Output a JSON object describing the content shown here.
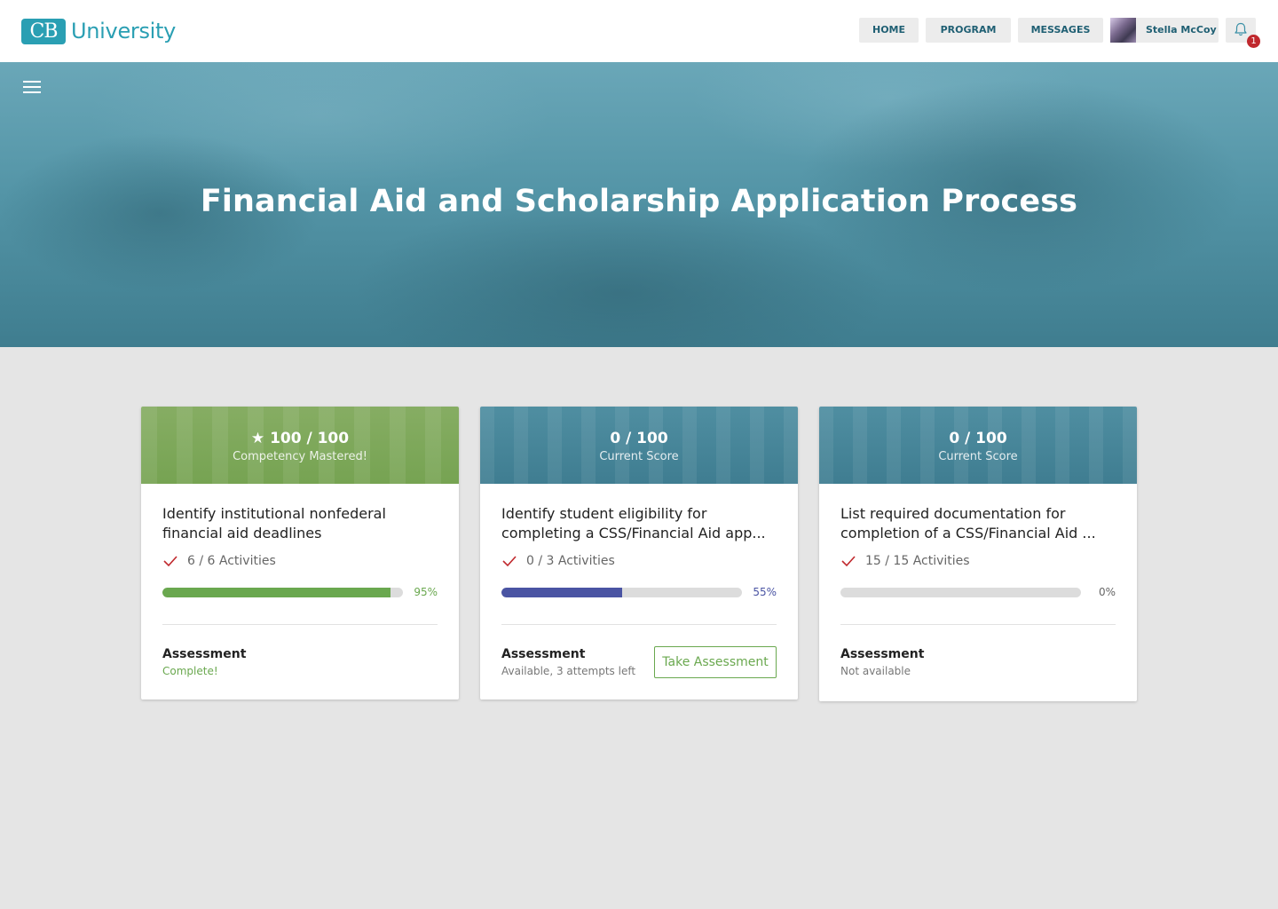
{
  "brand": {
    "mark": "CB",
    "name": "University",
    "color": "#2a9fb3"
  },
  "nav": {
    "home": "HOME",
    "program": "PROGRAM",
    "messages": "MESSAGES",
    "user_name": "Stella McCoy",
    "notification_count": "1"
  },
  "hero": {
    "title": "Financial Aid and Scholarship Application Process"
  },
  "cards": [
    {
      "score": "★ 100 / 100",
      "score_label": "Competency Mastered!",
      "title": "Identify institutional nonfederal financial aid deadlines",
      "activities": "6 / 6 Activities",
      "progress": 95,
      "progress_text": "95%",
      "progress_color": "#6aa84f",
      "assessment_label": "Assessment",
      "assessment_status": "Complete!",
      "status_color": "#6aa84f",
      "header_theme": "green"
    },
    {
      "score": "0 / 100",
      "score_label": "Current Score",
      "title": "Identify student eligibility for completing a CSS/Financial Aid app...",
      "activities": "0 / 3 Activities",
      "progress": 50,
      "progress_text": "55%",
      "progress_color": "#4a54a3",
      "assessment_label": "Assessment",
      "assessment_status": "Available, 3 attempts left",
      "status_color": "#777777",
      "action_label": "Take Assessment",
      "header_theme": "blue"
    },
    {
      "score": "0 / 100",
      "score_label": "Current Score",
      "title": "List required documentation for completion of a CSS/Financial Aid ...",
      "activities": "15 / 15 Activities",
      "progress": 0,
      "progress_text": "0%",
      "progress_color": "#666666",
      "assessment_label": "Assessment",
      "assessment_status": "Not available",
      "status_color": "#777777",
      "header_theme": "blue"
    }
  ],
  "colors": {
    "check": "#c0282d",
    "nav_text": "#1f5f73",
    "badge": "#c0282d"
  },
  "icons": [
    "hamburger-menu-icon",
    "bell-icon",
    "check-icon"
  ]
}
